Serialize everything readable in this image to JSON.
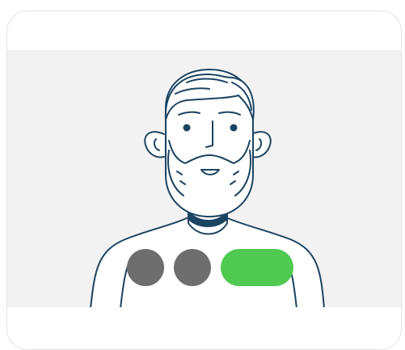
{
  "colors": {
    "card_border": "#e3e3e3",
    "video_background": "#f2f2f2",
    "avatar_stroke": "#1b4461",
    "avatar_fill": "#ffffff",
    "control_gray": "#6e6e6e",
    "control_green": "#4fc94f"
  },
  "video_tile": {
    "avatar_icon": "bearded-man-avatar-icon"
  },
  "controls": {
    "buttons": [
      {
        "name": "control-button-1",
        "icon": "gray-circle",
        "color": "#6e6e6e"
      },
      {
        "name": "control-button-2",
        "icon": "gray-circle",
        "color": "#6e6e6e"
      },
      {
        "name": "control-button-3",
        "icon": "green-pill",
        "color": "#4fc94f"
      }
    ]
  }
}
